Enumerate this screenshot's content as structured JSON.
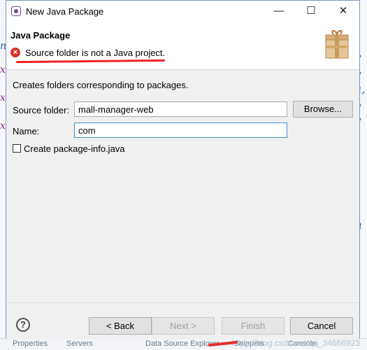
{
  "window": {
    "title": "New Java Package",
    "minimize_glyph": "—",
    "maximize_glyph": "☐",
    "close_glyph": "✕"
  },
  "header": {
    "title": "Java Package",
    "error_message": "Source folder is not a Java project.",
    "error_icon": "error-icon",
    "banner_icon": "package-icon"
  },
  "form": {
    "description": "Creates folders corresponding to packages.",
    "source_folder_label": "Source folder:",
    "source_folder_value": "mall-manager-web",
    "browse_label": "Browse...",
    "name_label": "Name:",
    "name_value": "com",
    "create_package_info_label": "Create package-info.java",
    "create_package_info_checked": false
  },
  "footer": {
    "help_glyph": "?",
    "back_label": "< Back",
    "next_label": "Next >",
    "finish_label": "Finish",
    "cancel_label": "Cancel"
  },
  "background": {
    "watermark": "https://blog.csdn.net/qq_34666923",
    "status_fragments": [
      "Properties",
      "Servers",
      "Data Source Explorer",
      "Snippets",
      "Console"
    ]
  },
  "colors": {
    "error_red": "#d9302a",
    "annotation_red": "#e22222",
    "focus_blue": "#3b8fd6"
  }
}
